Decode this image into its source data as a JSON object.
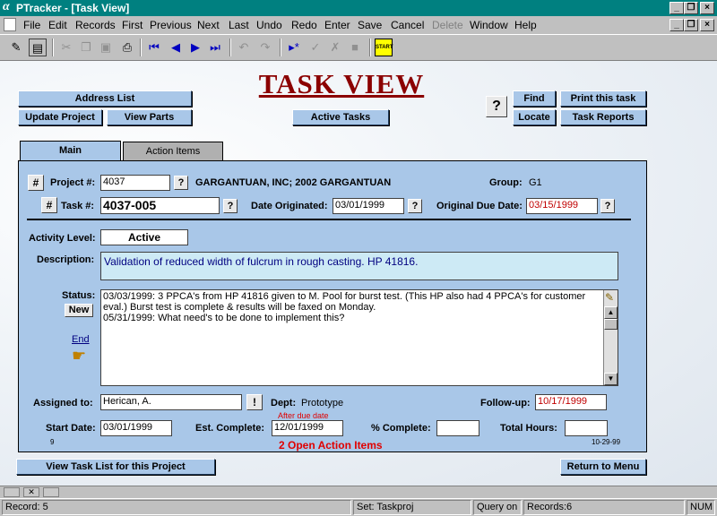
{
  "window": {
    "title": "PTracker - [Task View]",
    "logo_glyph": "α",
    "controls": [
      "_",
      "❐",
      "×"
    ]
  },
  "menu": [
    "File",
    "Edit",
    "Records",
    "First",
    "Previous",
    "Next",
    "Last",
    "Undo",
    "Redo",
    "Enter",
    "Save",
    "Cancel",
    "Delete",
    "Window",
    "Help"
  ],
  "menu_disabled": [
    "Delete"
  ],
  "toolbar": {
    "icons": [
      "pencil-icon",
      "form-view-icon",
      "cut-icon",
      "copy-icon",
      "paste-icon",
      "print-icon",
      "first-record-icon",
      "previous-record-icon",
      "next-record-icon",
      "last-record-icon",
      "undo-icon",
      "redo-icon",
      "new-record-icon",
      "save-record-icon",
      "delete-record-icon",
      "stop-icon",
      "start-icon"
    ],
    "start_label": "START"
  },
  "heading": "TASK VIEW",
  "buttons": {
    "address_list": "Address List",
    "update_project": "Update Project",
    "view_parts": "View Parts",
    "active_tasks": "Active Tasks",
    "help": "?",
    "find": "Find",
    "locate": "Locate",
    "print_task": "Print this task",
    "task_reports": "Task Reports",
    "view_task_list": "View Task List for this Project",
    "return_menu": "Return to Menu",
    "new_status": "New",
    "end": "End",
    "hash": "#",
    "q": "?",
    "excl": "!"
  },
  "tabs": [
    {
      "label": "Main",
      "active": true
    },
    {
      "label": "Action Items",
      "active": false
    }
  ],
  "form": {
    "project_label": "Project #:",
    "project_value": "4037",
    "company": "GARGANTUAN, INC;  2002 GARGANTUAN",
    "group_label": "Group:",
    "group_value": "G1",
    "task_label": "Task #:",
    "task_value": "4037-005",
    "date_originated_label": "Date Originated:",
    "date_originated": "03/01/1999",
    "original_due_label": "Original Due Date:",
    "original_due": "03/15/1999",
    "activity_label": "Activity Level:",
    "activity_value": "Active",
    "description_label": "Description:",
    "description": "Validation of reduced width of fulcrum in rough casting.  HP 41816.",
    "status_label": "Status:",
    "status_lines": [
      "03/03/1999: 3 PPCA's from HP 41816 given to M. Pool for burst test.   (This HP also had 4 PPCA's for customer",
      "eval.)  Burst test is complete &  results will be faxed on Monday.",
      "05/31/1999: What need's to be done to implement this?"
    ],
    "assigned_label": "Assigned to:",
    "assigned_value": "Herican, A.",
    "dept_label": "Dept:",
    "dept_value": "Prototype",
    "followup_label": "Follow-up:",
    "followup_value": "10/17/1999",
    "after_due": "After due date",
    "start_label": "Start Date:",
    "start_value": "03/01/1999",
    "est_label": "Est. Complete:",
    "est_value": "12/01/1999",
    "pct_label": "% Complete:",
    "pct_value": "",
    "hours_label": "Total Hours:",
    "hours_value": "",
    "record_num": "9",
    "open_items": "2 Open Action Items",
    "footer_date": "10-29-99"
  },
  "statusbar": {
    "record": "Record: 5",
    "set": "Set: Taskproj",
    "query": "Query on",
    "records": "Records:6",
    "num": "NUM"
  },
  "colors": {
    "titlebar": "#008080",
    "panel": "#a9c7e8",
    "heading": "#8b0000",
    "alert_red": "#e00000"
  }
}
